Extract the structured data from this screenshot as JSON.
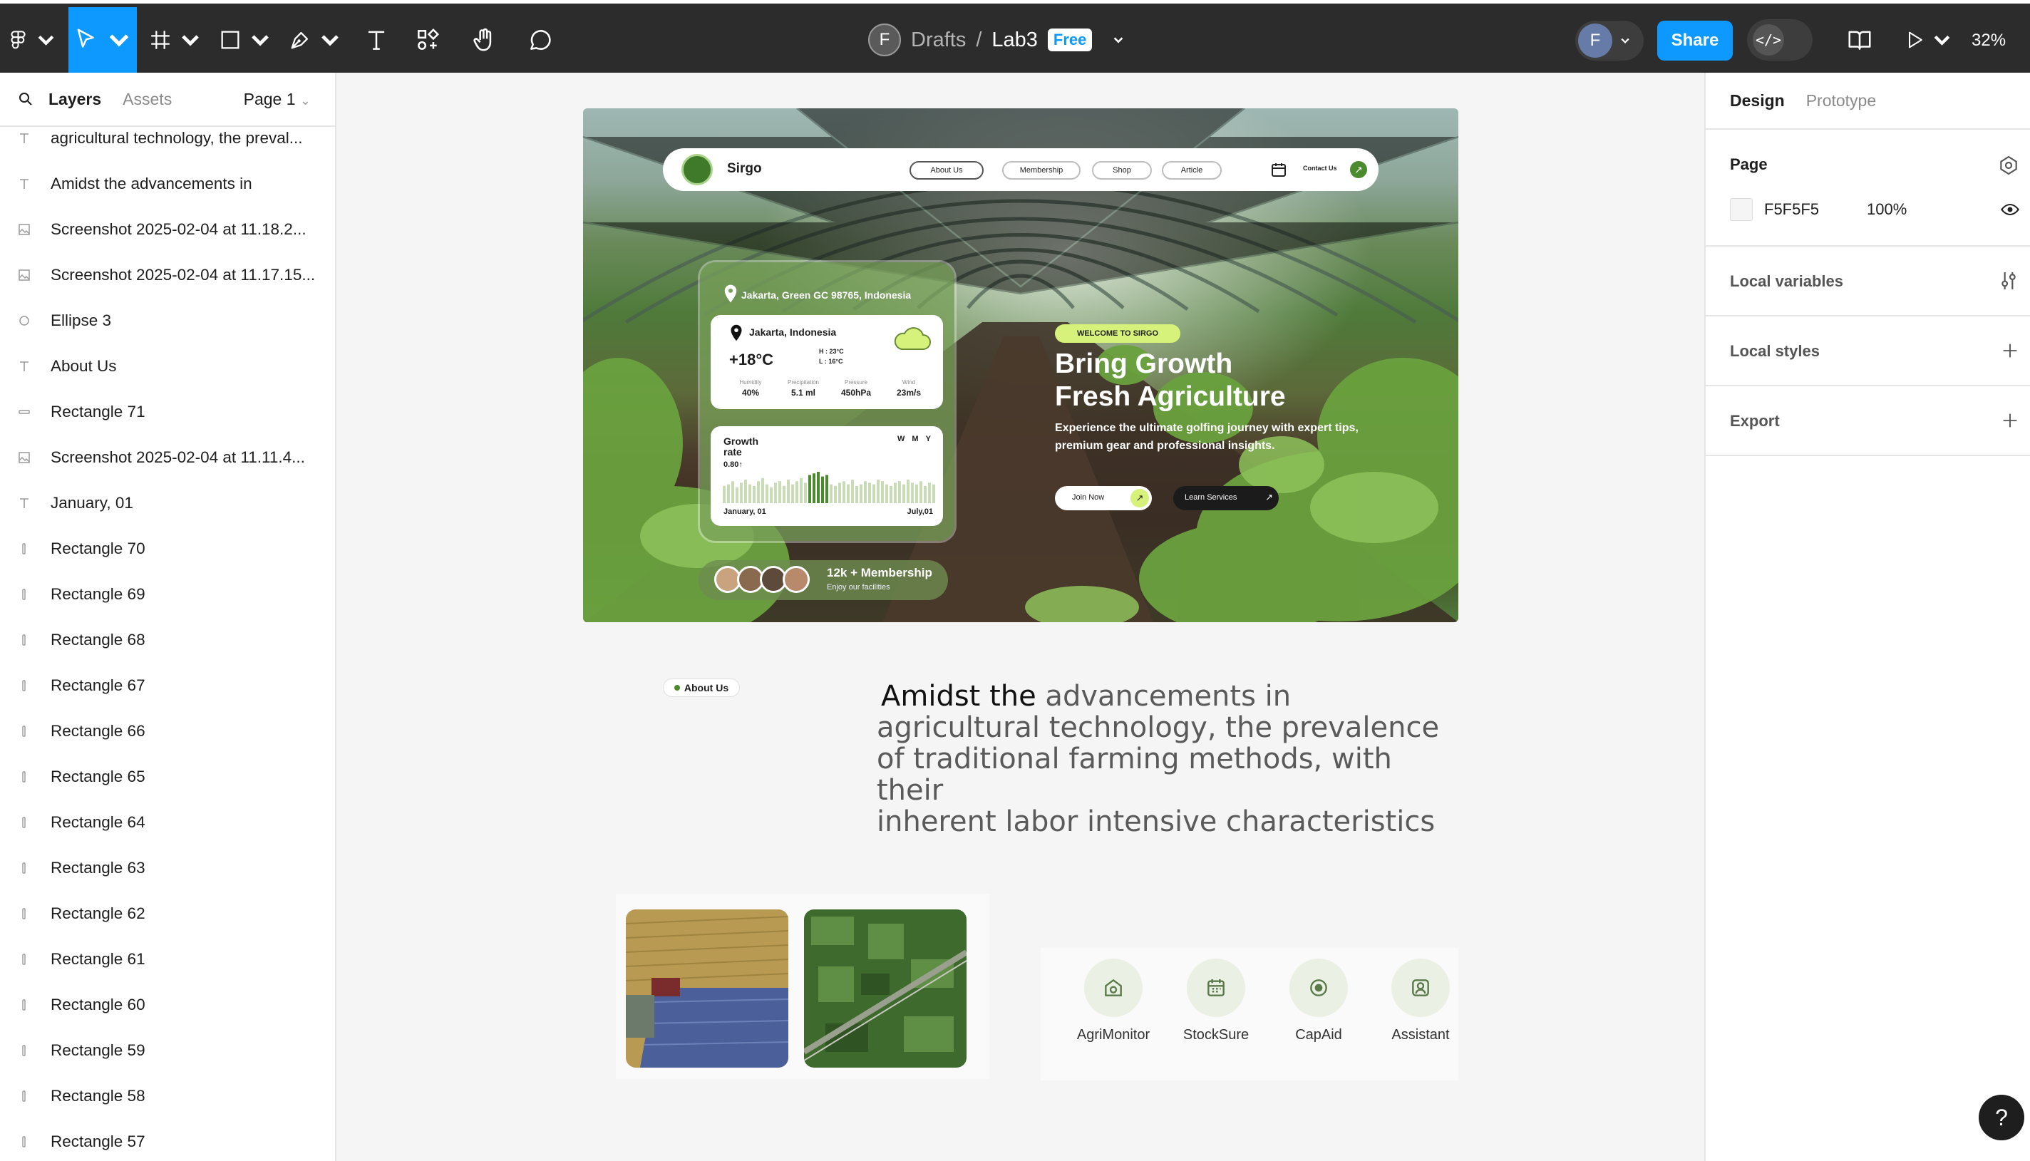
{
  "toolbar": {
    "file": {
      "owner_initial": "F",
      "folder": "Drafts",
      "separator": "/",
      "name": "Lab3",
      "plan_badge": "Free"
    },
    "user_initial": "F",
    "share_label": "Share",
    "dev_mode_glyph": "</>",
    "zoom": "32%"
  },
  "left_panel": {
    "tabs": [
      "Layers",
      "Assets"
    ],
    "page_selector": "Page 1",
    "layers": [
      {
        "type": "text",
        "name": "agricultural technology, the preval..."
      },
      {
        "type": "text",
        "name": "Amidst the advancements in"
      },
      {
        "type": "image",
        "name": "Screenshot 2025-02-04 at 11.18.2..."
      },
      {
        "type": "image",
        "name": "Screenshot 2025-02-04 at 11.17.15..."
      },
      {
        "type": "ellipse",
        "name": "Ellipse 3"
      },
      {
        "type": "text",
        "name": "About Us"
      },
      {
        "type": "rect-h",
        "name": "Rectangle 71"
      },
      {
        "type": "image",
        "name": "Screenshot 2025-02-04 at 11.11.4..."
      },
      {
        "type": "text",
        "name": "January, 01"
      },
      {
        "type": "rect-v",
        "name": "Rectangle 70"
      },
      {
        "type": "rect-v",
        "name": "Rectangle 69"
      },
      {
        "type": "rect-v",
        "name": "Rectangle 68"
      },
      {
        "type": "rect-v",
        "name": "Rectangle 67"
      },
      {
        "type": "rect-v",
        "name": "Rectangle 66"
      },
      {
        "type": "rect-v",
        "name": "Rectangle 65"
      },
      {
        "type": "rect-v",
        "name": "Rectangle 64"
      },
      {
        "type": "rect-v",
        "name": "Rectangle 63"
      },
      {
        "type": "rect-v",
        "name": "Rectangle 62"
      },
      {
        "type": "rect-v",
        "name": "Rectangle 61"
      },
      {
        "type": "rect-v",
        "name": "Rectangle 60"
      },
      {
        "type": "rect-v",
        "name": "Rectangle 59"
      },
      {
        "type": "rect-v",
        "name": "Rectangle 58"
      },
      {
        "type": "rect-v",
        "name": "Rectangle 57"
      }
    ]
  },
  "right_panel": {
    "tabs": [
      "Design",
      "Prototype"
    ],
    "page_title": "Page",
    "page_fill": {
      "hex": "F5F5F5",
      "opacity": "100%",
      "swatch": "#F5F5F5"
    },
    "sections": [
      "Local variables",
      "Local styles",
      "Export"
    ]
  },
  "design": {
    "nav": {
      "brand": "Sirgo",
      "links": [
        "About Us",
        "Membership",
        "Shop",
        "Article"
      ],
      "contact": "Contact Us"
    },
    "weather": {
      "address": "Jakarta, Green GC 98765, Indonesia",
      "city": "Jakarta, Indonesia",
      "temp": "+18°C",
      "high": "H : 23°C",
      "low": "L : 16°C",
      "stats": [
        {
          "label": "Humidity",
          "value": "40%"
        },
        {
          "label": "Precipitation",
          "value": "5.1 ml"
        },
        {
          "label": "Pressure",
          "value": "450hPa"
        },
        {
          "label": "Wind",
          "value": "23m/s"
        }
      ],
      "growth_title": "Growth rate",
      "growth_value": "0.80↑",
      "ranges": [
        "W",
        "M",
        "Y"
      ],
      "start": "January, 01",
      "end": "July,01",
      "bars": [
        0.55,
        0.6,
        0.7,
        0.5,
        0.65,
        0.75,
        0.6,
        0.55,
        0.7,
        0.8,
        0.6,
        0.5,
        0.65,
        0.7,
        0.55,
        0.75,
        0.6,
        0.7,
        0.8,
        0.65,
        0.9,
        0.95,
        1.0,
        0.85,
        0.9,
        0.6,
        0.55,
        0.65,
        0.7,
        0.6,
        0.75,
        0.55,
        0.6,
        0.7,
        0.65,
        0.6,
        0.75,
        0.7,
        0.6,
        0.55,
        0.65,
        0.7,
        0.6,
        0.75,
        0.65,
        0.6,
        0.7,
        0.55,
        0.65,
        0.6
      ]
    },
    "membership": {
      "title": "12k + Membership",
      "subtitle": "Enjoy our facilities"
    },
    "hero": {
      "badge": "WELCOME TO SIRGO",
      "headline_1": "Bring Growth",
      "headline_2": "Fresh Agriculture",
      "body_1": "Experience the ultimate golfing journey with expert tips,",
      "body_2": "premium gear and professional insights.",
      "join": "Join Now",
      "learn": "Learn Services"
    },
    "about_pill": "About Us",
    "statement": {
      "lead": "Amidst the",
      "rest_1": " advancements in",
      "line_2": "agricultural technology, the prevalence",
      "line_3": "of traditional farming methods, with their",
      "line_4": "inherent labor intensive characteristics"
    },
    "services": [
      {
        "icon": "monitor-icon",
        "label": "AgriMonitor"
      },
      {
        "icon": "calendar-icon",
        "label": "StockSure"
      },
      {
        "icon": "coin-icon",
        "label": "CapAid"
      },
      {
        "icon": "user-icon",
        "label": "Assistant"
      }
    ]
  },
  "help_glyph": "?",
  "colors": {
    "accent": "#0d99ff",
    "toolbar": "#2c2c2c",
    "brand_green": "#4c8a2e",
    "lime": "#d7f27a"
  }
}
